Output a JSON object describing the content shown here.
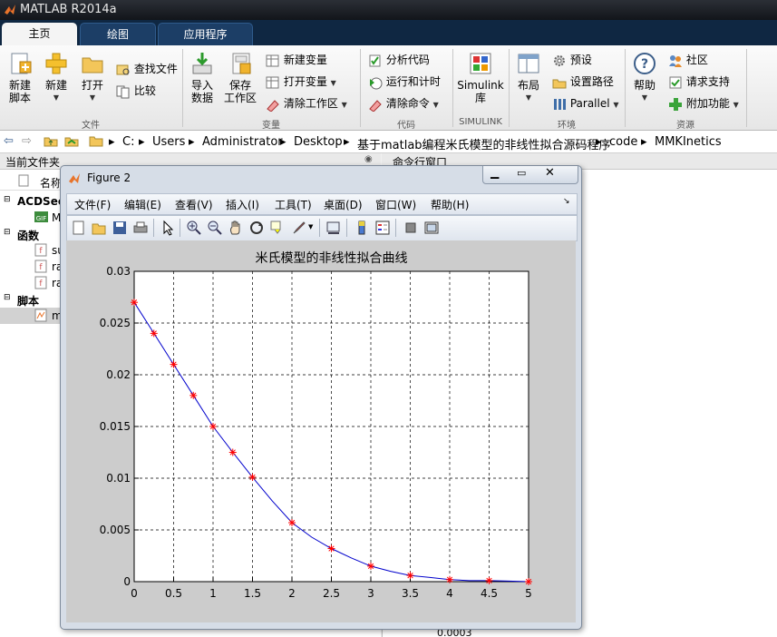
{
  "app": {
    "title": "MATLAB R2014a"
  },
  "tabs": [
    {
      "label": "主页"
    },
    {
      "label": "绘图"
    },
    {
      "label": "应用程序"
    }
  ],
  "ribbon": {
    "new_script": "新建\n脚本",
    "new": "新建",
    "open": "打开",
    "find_files": "查找文件",
    "compare": "比较",
    "import_data": "导入\n数据",
    "save_workspace": "保存\n工作区",
    "new_variable": "新建变量",
    "open_variable": "打开变量",
    "clear_workspace": "清除工作区",
    "analyze_code": "分析代码",
    "run_and_time": "运行和计时",
    "clear_commands": "清除命令",
    "simulink": "Simulink\n库",
    "layout": "布局",
    "preferences": "预设",
    "set_path": "设置路径",
    "parallel": "Parallel",
    "help": "帮助",
    "community": "社区",
    "request_support": "请求支持",
    "add_ons": "附加功能",
    "groups": {
      "file": "文件",
      "variable": "变量",
      "code": "代码",
      "simulink": "SIMULINK",
      "environment": "环境",
      "resources": "资源"
    }
  },
  "breadcrumb": [
    "C:",
    "Users",
    "Administrator",
    "Desktop",
    "基于matlab编程米氏模型的非线性拟合源码程序",
    "code",
    "MMKInetics"
  ],
  "left_panel": {
    "header": "当前文件夹",
    "column": "名称",
    "tree": [
      {
        "label": "ACDSee",
        "bold": true
      },
      {
        "label": "M"
      },
      {
        "label": "函数",
        "bold": true
      },
      {
        "label": "su"
      },
      {
        "label": "ra"
      },
      {
        "label": "ra"
      },
      {
        "label": "脚本",
        "bold": true
      },
      {
        "label": "m"
      }
    ]
  },
  "right_panel": {
    "header": "命令行窗口",
    "bottom_value": "0.0003"
  },
  "figure": {
    "title": "Figure 2",
    "menus": [
      "文件(F)",
      "编辑(E)",
      "查看(V)",
      "插入(I)",
      "工具(T)",
      "桌面(D)",
      "窗口(W)",
      "帮助(H)"
    ]
  },
  "chart_data": {
    "type": "line",
    "title": "米氏模型的非线性拟合曲线",
    "xlim": [
      0,
      5
    ],
    "ylim": [
      0,
      0.03
    ],
    "xticks": [
      "0",
      "0.5",
      "1",
      "1.5",
      "2",
      "2.5",
      "3",
      "3.5",
      "4",
      "4.5",
      "5"
    ],
    "yticks": [
      "0",
      "0.005",
      "0.01",
      "0.015",
      "0.02",
      "0.025",
      "0.03"
    ],
    "grid": true,
    "series": [
      {
        "style": "line",
        "color": "#0000cc",
        "x": [
          0,
          0.25,
          0.5,
          0.75,
          1,
          1.25,
          1.5,
          1.75,
          2,
          2.25,
          2.5,
          2.75,
          3,
          3.25,
          3.5,
          3.75,
          4,
          4.25,
          4.5,
          4.75,
          5
        ],
        "y": [
          0.027,
          0.024,
          0.021,
          0.018,
          0.015,
          0.0125,
          0.0101,
          0.0078,
          0.0057,
          0.0043,
          0.0032,
          0.0023,
          0.0015,
          0.001,
          0.0006,
          0.0004,
          0.0002,
          0.0001,
          0.0001,
          5e-05,
          0.0
        ]
      },
      {
        "style": "marker",
        "marker": "*",
        "color": "#ff0000",
        "x": [
          0,
          0.25,
          0.5,
          0.75,
          1,
          1.25,
          1.5,
          2,
          2.5,
          3,
          3.5,
          4,
          4.5,
          5
        ],
        "y": [
          0.027,
          0.024,
          0.021,
          0.018,
          0.015,
          0.0125,
          0.0101,
          0.0057,
          0.0032,
          0.0015,
          0.0006,
          0.0002,
          0.0001,
          0.0
        ]
      }
    ]
  }
}
